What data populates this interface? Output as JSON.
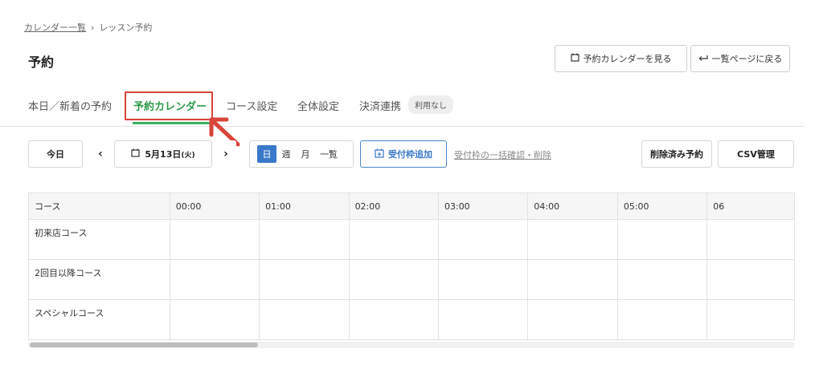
{
  "breadcrumb": {
    "link": "カレンダー一覧",
    "separator": "›",
    "current": "レッスン予約"
  },
  "page": {
    "title": "予約"
  },
  "header_buttons": {
    "calendar_view": "予約カレンダーを見る",
    "back_to_list": "一覧ページに戻る"
  },
  "tabs": [
    {
      "label": "本日／新着の予約"
    },
    {
      "label": "予約カレンダー",
      "active": true
    },
    {
      "label": "コース設定"
    },
    {
      "label": "全体設定"
    },
    {
      "label": "決済連携",
      "badge": "利用なし"
    }
  ],
  "toolbar": {
    "today": "今日",
    "prev": "‹",
    "date_main": "5月13日",
    "date_weekday": "(火)",
    "next": "›",
    "views": [
      "日",
      "週",
      "月",
      "一覧"
    ],
    "active_view": "日",
    "add_slot": "受付枠追加",
    "bulk_link": "受付枠の一括確認・削除",
    "deleted": "削除済み予約",
    "csv": "CSV管理"
  },
  "grid": {
    "course_header": "コース",
    "hours": [
      "00:00",
      "01:00",
      "02:00",
      "03:00",
      "04:00",
      "05:00",
      "06"
    ],
    "courses": [
      "初来店コース",
      "2回目以降コース",
      "スペシャルコース"
    ]
  },
  "colors": {
    "accent_green": "#2e9b4b",
    "highlight_red": "#d9443a",
    "primary_blue": "#3a78c9"
  },
  "icons": [
    "calendar-icon",
    "return-arrow-icon",
    "calendar-plus-icon",
    "annotation-arrow-icon"
  ]
}
